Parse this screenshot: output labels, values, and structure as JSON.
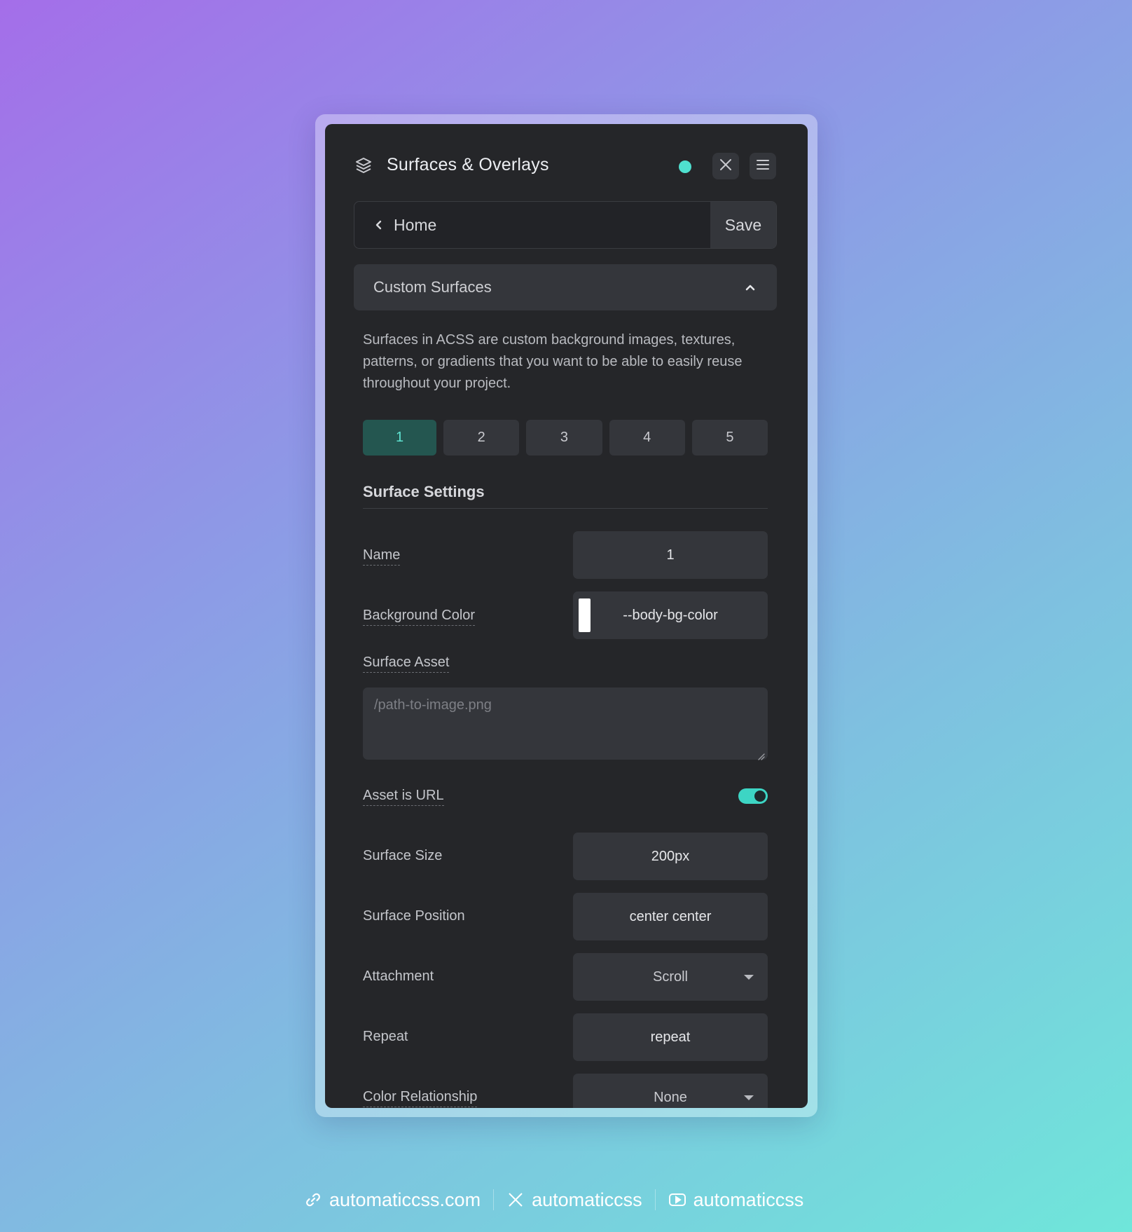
{
  "header": {
    "title": "Surfaces & Overlays",
    "icon": "layers-icon",
    "status_color": "#4fe0cf"
  },
  "nav": {
    "home_label": "Home",
    "save_label": "Save"
  },
  "accordion": {
    "label": "Custom Surfaces"
  },
  "description": "Surfaces in ACSS are custom background images, textures, patterns, or gradients that you want to be able to easily reuse throughout your project.",
  "tabs": [
    {
      "label": "1",
      "active": true
    },
    {
      "label": "2",
      "active": false
    },
    {
      "label": "3",
      "active": false
    },
    {
      "label": "4",
      "active": false
    },
    {
      "label": "5",
      "active": false
    }
  ],
  "settings": {
    "title": "Surface Settings",
    "name": {
      "label": "Name",
      "value": "1"
    },
    "background_color": {
      "label": "Background Color",
      "value": "--body-bg-color",
      "swatch": "#ffffff"
    },
    "surface_asset": {
      "label": "Surface Asset",
      "placeholder": "/path-to-image.png"
    },
    "asset_is_url": {
      "label": "Asset is URL",
      "on": true
    },
    "surface_size": {
      "label": "Surface Size",
      "value": "200px"
    },
    "surface_position": {
      "label": "Surface Position",
      "value": "center center"
    },
    "attachment": {
      "label": "Attachment",
      "value": "Scroll"
    },
    "repeat": {
      "label": "Repeat",
      "value": "repeat"
    },
    "color_relationship": {
      "label": "Color Relationship",
      "value": "None"
    }
  },
  "footer": {
    "website": "automaticcss.com",
    "x_handle": "automaticcss",
    "youtube_handle": "automaticcss"
  },
  "colors": {
    "accent": "#4fe0cf",
    "panel_bg": "#252629",
    "tab_active_bg": "#245650"
  }
}
